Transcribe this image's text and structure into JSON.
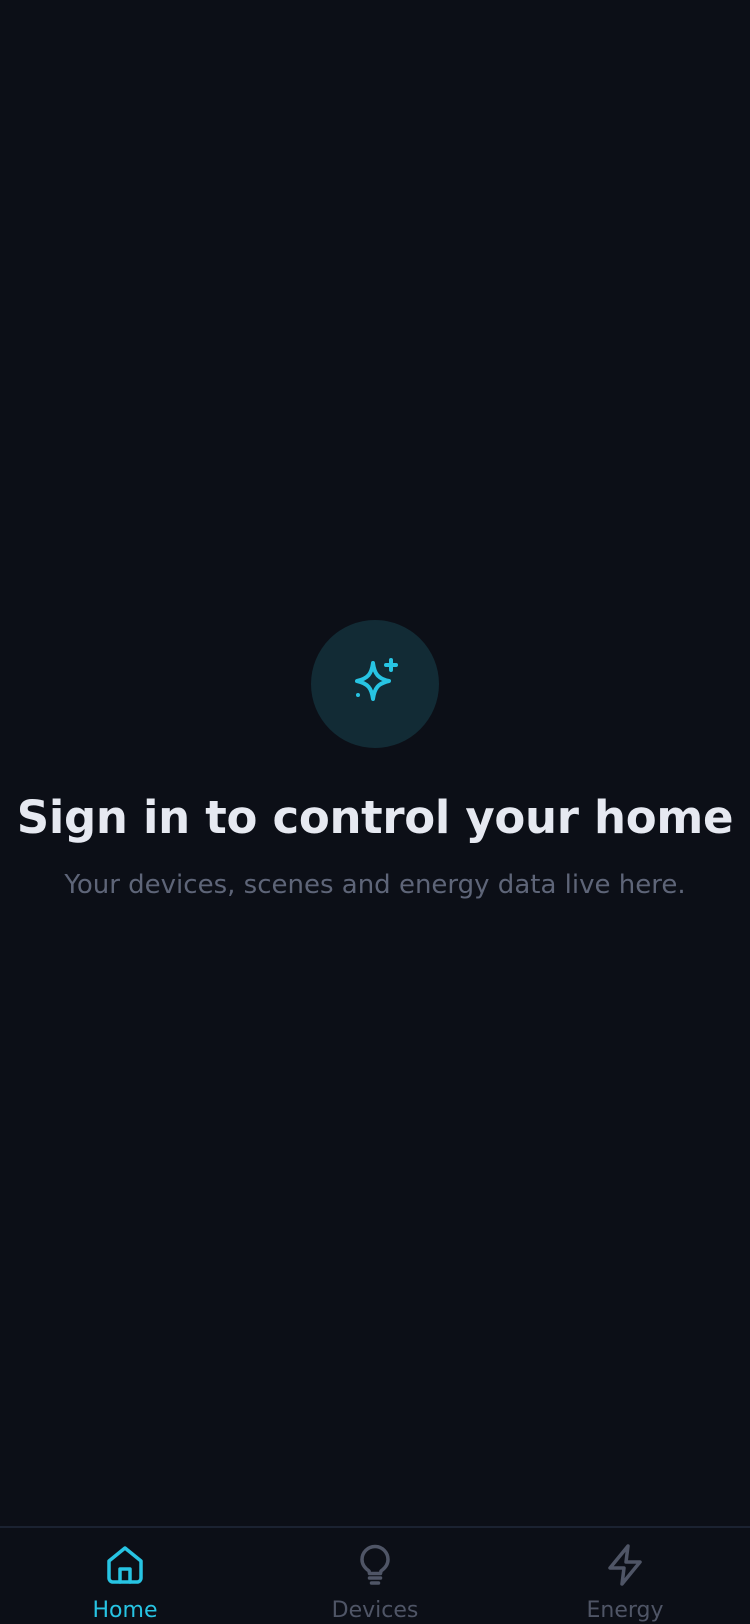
{
  "accent_color": "#27c4e3",
  "muted_color": "#4f5566",
  "empty_state": {
    "icon": "sparkles-icon",
    "title": "Sign in to control your home",
    "subtitle": "Your devices, scenes and energy data live here."
  },
  "tabbar": {
    "selected": "Home",
    "tabs": [
      {
        "label": "Home",
        "icon": "home-icon",
        "active": true
      },
      {
        "label": "Devices",
        "icon": "lightbulb-icon",
        "active": false
      },
      {
        "label": "Energy",
        "icon": "lightning-bolt-icon",
        "active": false
      }
    ]
  }
}
